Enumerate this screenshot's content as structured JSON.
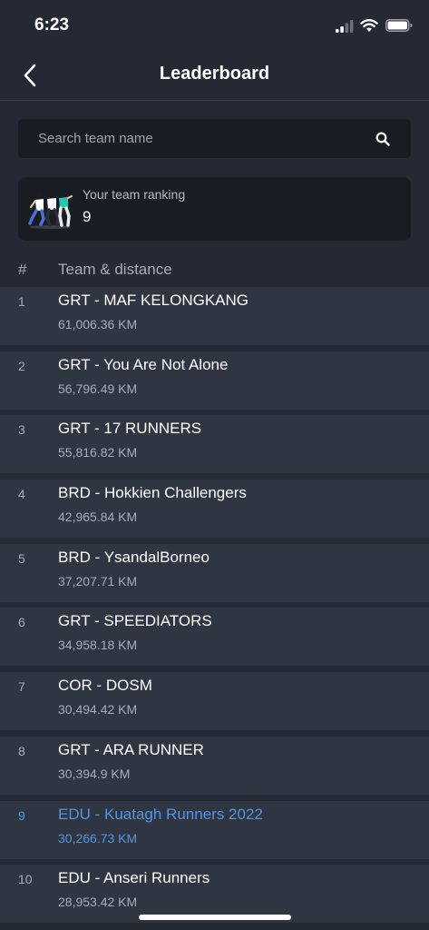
{
  "status_bar": {
    "time": "6:23"
  },
  "header": {
    "title": "Leaderboard"
  },
  "search": {
    "placeholder": "Search team name"
  },
  "ranking": {
    "label": "Your team ranking",
    "value": "9"
  },
  "table": {
    "rank_header": "#",
    "team_header": "Team & distance"
  },
  "rows": [
    {
      "rank": "1",
      "name": "GRT - MAF KELONGKANG",
      "distance": "61,006.36 KM"
    },
    {
      "rank": "2",
      "name": "GRT - You Are Not Alone",
      "distance": "56,796.49 KM"
    },
    {
      "rank": "3",
      "name": "GRT - 17 RUNNERS",
      "distance": "55,816.82 KM"
    },
    {
      "rank": "4",
      "name": "BRD - Hokkien Challengers",
      "distance": "42,965.84 KM"
    },
    {
      "rank": "5",
      "name": "BRD - YsandalBorneo",
      "distance": "37,207.71 KM"
    },
    {
      "rank": "6",
      "name": "GRT - SPEEDIATORS",
      "distance": "34,958.18 KM"
    },
    {
      "rank": "7",
      "name": "COR - DOSM",
      "distance": "30,494.42 KM"
    },
    {
      "rank": "8",
      "name": "GRT - ARA RUNNER",
      "distance": "30,394.9 KM"
    },
    {
      "rank": "9",
      "name": "EDU - Kuatagh Runners 2022",
      "distance": "30,266.73 KM"
    },
    {
      "rank": "10",
      "name": "EDU - Anseri Runners",
      "distance": "28,953.42 KM"
    }
  ],
  "colors": {
    "background": "#242933",
    "row_background": "#2f3541",
    "card_background": "#181c23",
    "highlight": "#4f97e8"
  }
}
